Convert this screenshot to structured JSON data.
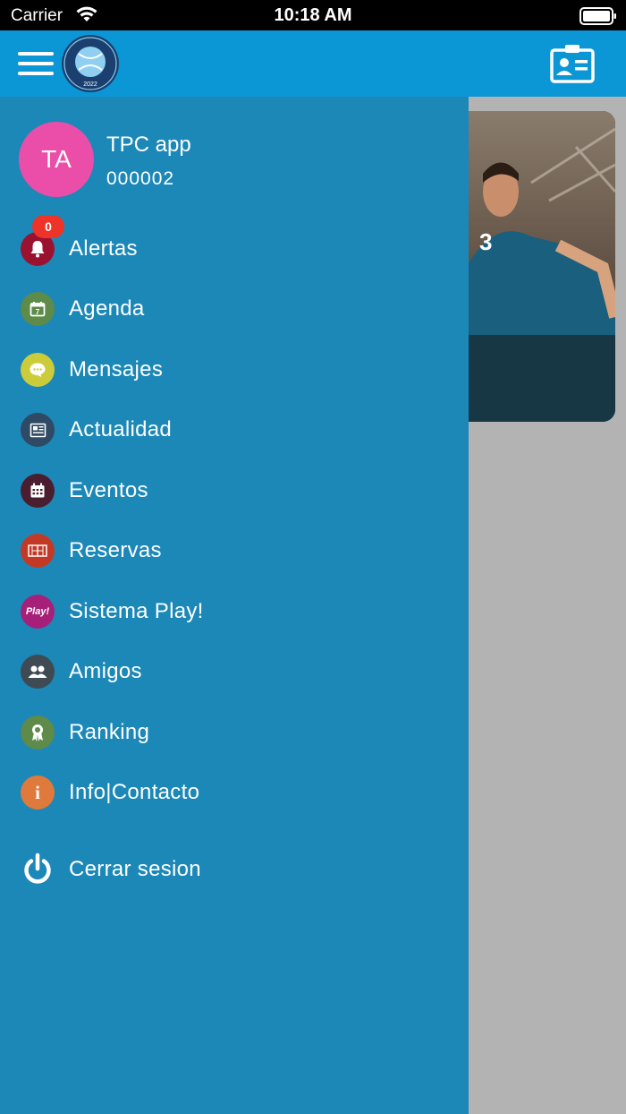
{
  "status_bar": {
    "carrier": "Carrier",
    "time": "10:18 AM"
  },
  "header": {
    "logo_text_top": "VERIN PADEL INDOOR",
    "logo_year": "2022"
  },
  "user": {
    "initials": "TA",
    "name": "TPC app",
    "id": "000002"
  },
  "menu": [
    {
      "label": "Alertas",
      "icon": "bell-icon",
      "color": "#9b1230",
      "badge": "0"
    },
    {
      "label": "Agenda",
      "icon": "calendar-day-icon",
      "color": "#5e8a4a"
    },
    {
      "label": "Mensajes",
      "icon": "chat-icon",
      "color": "#cccc3a"
    },
    {
      "label": "Actualidad",
      "icon": "newspaper-icon",
      "color": "#2e4a64"
    },
    {
      "label": "Eventos",
      "icon": "calendar-icon",
      "color": "#4a1e2e"
    },
    {
      "label": "Reservas",
      "icon": "court-icon",
      "color": "#c23a26"
    },
    {
      "label": "Sistema Play!",
      "icon": "play-badge-icon",
      "color": "#a6207a",
      "icon_text": "Play!"
    },
    {
      "label": "Amigos",
      "icon": "friends-icon",
      "color": "#3f4a52"
    },
    {
      "label": "Ranking",
      "icon": "award-icon",
      "color": "#5e8a4a"
    },
    {
      "label": "Info|Contacto",
      "icon": "info-icon",
      "color": "#e07a3c",
      "icon_text": "i"
    }
  ],
  "logout": {
    "label": "Cerrar sesion",
    "icon": "power-icon"
  },
  "colors": {
    "topbar": "#0b96d6",
    "drawer": "#1c88b8",
    "avatar": "#ea4ea8",
    "badge": "#ee3329"
  }
}
